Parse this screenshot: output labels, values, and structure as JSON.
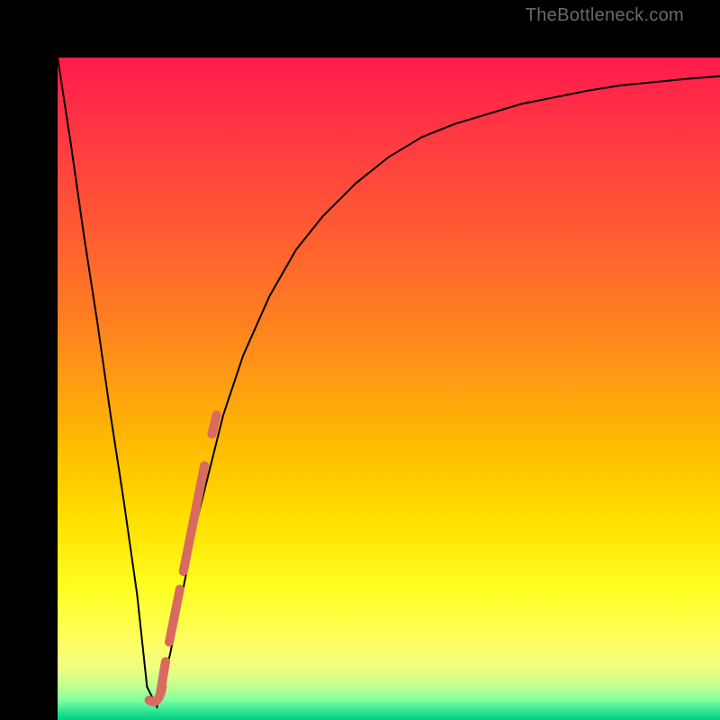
{
  "watermark": "TheBottleneck.com",
  "chart_data": {
    "type": "line",
    "title": "",
    "xlabel": "",
    "ylabel": "",
    "xlim": [
      0,
      100
    ],
    "ylim": [
      0,
      100
    ],
    "grid": false,
    "series": [
      {
        "name": "bottleneck-curve",
        "x": [
          0,
          2,
          4,
          6,
          8,
          10,
          12,
          13.5,
          15,
          17,
          19,
          21,
          23,
          25,
          28,
          32,
          36,
          40,
          45,
          50,
          55,
          60,
          65,
          70,
          75,
          80,
          85,
          90,
          95,
          100
        ],
        "values": [
          100,
          87,
          73,
          60,
          46,
          33,
          19,
          5,
          2,
          10,
          20,
          30,
          38,
          46,
          55,
          64,
          71,
          76,
          81,
          85,
          88,
          90,
          91.5,
          93,
          94,
          95,
          95.8,
          96.3,
          96.8,
          97.2
        ],
        "color": "#000000",
        "stroke_width": 2
      },
      {
        "name": "highlight-segment",
        "x": [
          15.5,
          16.5,
          17.5,
          18.5,
          19.5,
          20.5,
          21.5,
          22.5,
          23.5,
          24.5
        ],
        "values": [
          4,
          10,
          15,
          20,
          25,
          30,
          35,
          40,
          44,
          48
        ],
        "color": "#d86a60",
        "stroke_width": 10,
        "dashed": true
      }
    ],
    "background_gradient": {
      "type": "vertical",
      "stops": [
        {
          "pos": 0,
          "color": "#ff1a4a"
        },
        {
          "pos": 50,
          "color": "#ffa010"
        },
        {
          "pos": 80,
          "color": "#ffff20"
        },
        {
          "pos": 100,
          "color": "#00d080"
        }
      ]
    }
  }
}
